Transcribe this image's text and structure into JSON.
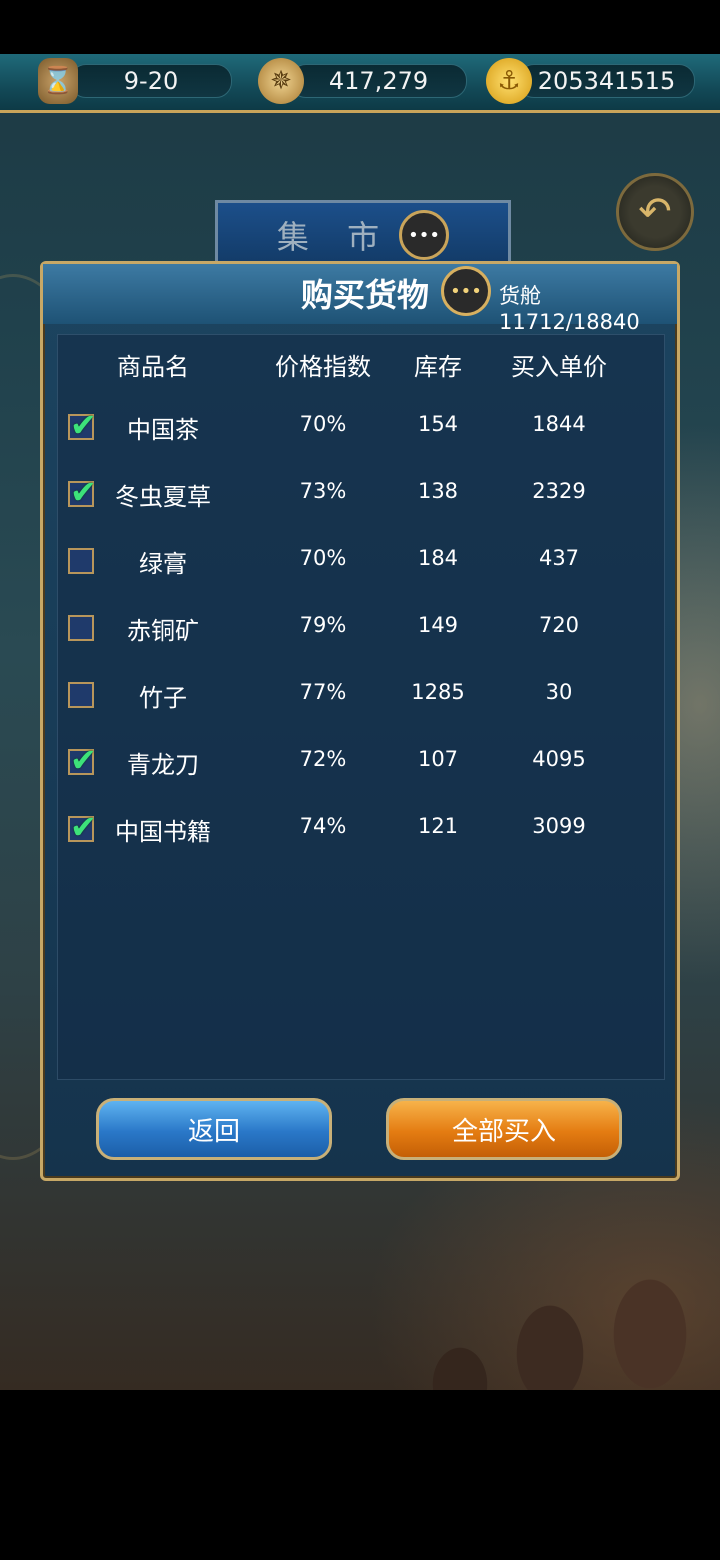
{
  "topbar": {
    "date": "9-20",
    "compass_value": "417,279",
    "gold_value": "205341515"
  },
  "icons": {
    "hourglass": "⌛",
    "compass": "✵",
    "gold": "⚓",
    "back": "↶",
    "chat": "•••"
  },
  "market": {
    "title": "集 市"
  },
  "dialog": {
    "title": "购买货物",
    "cargo": "货舱11712/18840",
    "headers": {
      "name": "商品名",
      "price_index": "价格指数",
      "stock": "库存",
      "unit_price": "买入单价"
    },
    "rows": [
      {
        "name": "中国茶",
        "price_index": "70%",
        "stock": "154",
        "unit_price": "1844",
        "checked": true
      },
      {
        "name": "冬虫夏草",
        "price_index": "73%",
        "stock": "138",
        "unit_price": "2329",
        "checked": true
      },
      {
        "name": "绿膏",
        "price_index": "70%",
        "stock": "184",
        "unit_price": "437",
        "checked": false
      },
      {
        "name": "赤铜矿",
        "price_index": "79%",
        "stock": "149",
        "unit_price": "720",
        "checked": false
      },
      {
        "name": "竹子",
        "price_index": "77%",
        "stock": "1285",
        "unit_price": "30",
        "checked": false
      },
      {
        "name": "青龙刀",
        "price_index": "72%",
        "stock": "107",
        "unit_price": "4095",
        "checked": true
      },
      {
        "name": "中国书籍",
        "price_index": "74%",
        "stock": "121",
        "unit_price": "3099",
        "checked": true
      }
    ],
    "check_glyph": "✔"
  },
  "buttons": {
    "back": "返回",
    "buy_all": "全部买入"
  },
  "colors": {
    "accent_gold": "#c7a866",
    "check_green": "#3de27a",
    "blue_button": "#2a78c8",
    "orange_button": "#e47c12"
  }
}
